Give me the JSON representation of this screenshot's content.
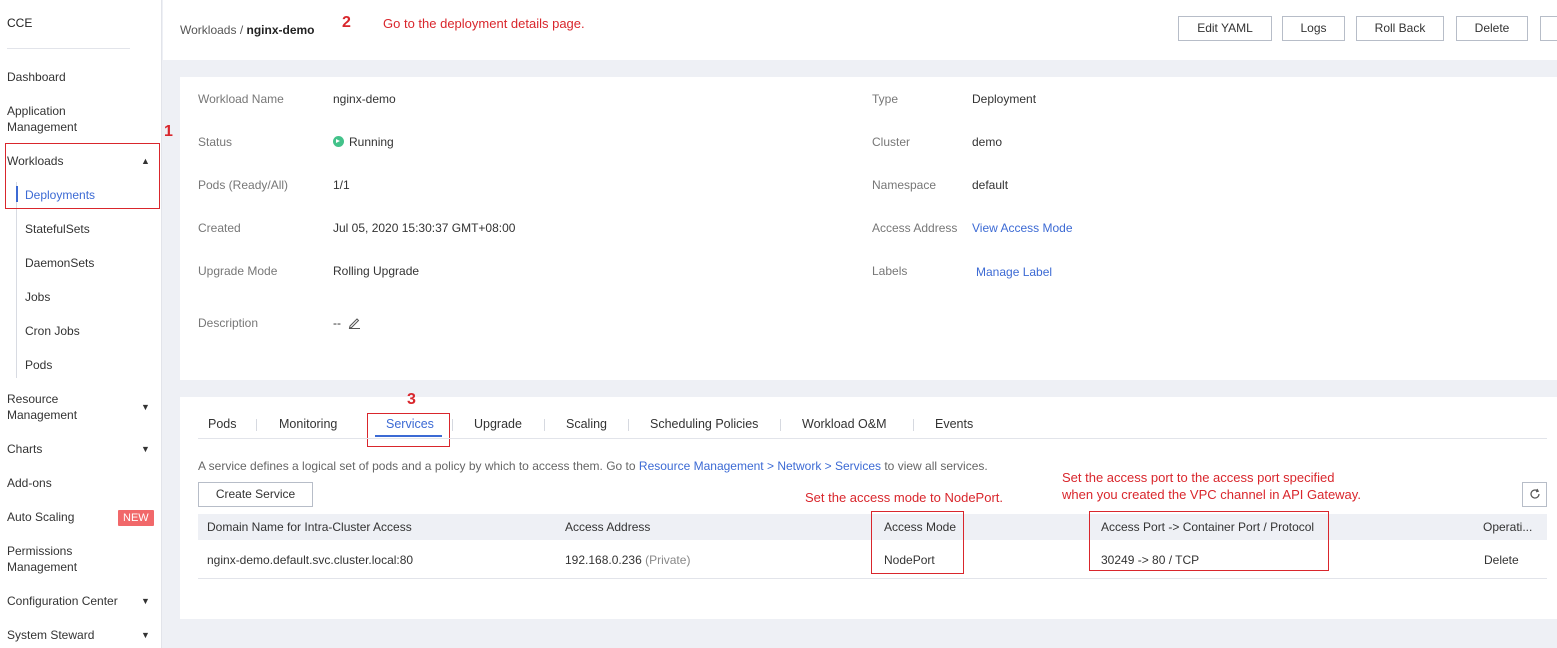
{
  "sidebar": {
    "brand": "CCE",
    "items": [
      {
        "label": "Dashboard"
      },
      {
        "label": "Application Management"
      },
      {
        "label": "Workloads"
      },
      {
        "label": "Deployments"
      },
      {
        "label": "StatefulSets"
      },
      {
        "label": "DaemonSets"
      },
      {
        "label": "Jobs"
      },
      {
        "label": "Cron Jobs"
      },
      {
        "label": "Pods"
      },
      {
        "label": "Resource Management"
      },
      {
        "label": "Charts"
      },
      {
        "label": "Add-ons"
      },
      {
        "label": "Auto Scaling",
        "badge": "NEW"
      },
      {
        "label": "Permissions Management"
      },
      {
        "label": "Configuration Center"
      },
      {
        "label": "System Steward"
      }
    ]
  },
  "breadcrumb": {
    "parent": "Workloads",
    "sep": "/",
    "current": "nginx-demo"
  },
  "header_buttons": [
    "Edit YAML",
    "Logs",
    "Roll Back",
    "Delete"
  ],
  "annotations": {
    "n1": "1",
    "n2": "2",
    "n2_text": "Go to the deployment details page.",
    "n3": "3",
    "mode_text": "Set the access mode to NodePort.",
    "port_text_1": "Set the access port to the access port specified",
    "port_text_2": "when you created the VPC channel in API Gateway."
  },
  "details": {
    "workload_name_label": "Workload Name",
    "workload_name": "nginx-demo",
    "status_label": "Status",
    "status": "Running",
    "pods_label": "Pods (Ready/All)",
    "pods": "1/1",
    "created_label": "Created",
    "created": "Jul 05, 2020 15:30:37 GMT+08:00",
    "upgrade_label": "Upgrade Mode",
    "upgrade": "Rolling Upgrade",
    "description_label": "Description",
    "description": "--",
    "type_label": "Type",
    "type": "Deployment",
    "cluster_label": "Cluster",
    "cluster": "demo",
    "namespace_label": "Namespace",
    "namespace": "default",
    "access_label": "Access Address",
    "access": "View Access Mode",
    "labels_label": "Labels",
    "labels": "Manage Label"
  },
  "tabs": [
    "Pods",
    "Monitoring",
    "Services",
    "Upgrade",
    "Scaling",
    "Scheduling Policies",
    "Workload O&M",
    "Events"
  ],
  "services": {
    "desc_prefix": "A service defines a logical set of pods and a policy by which to access them. Go to ",
    "desc_link": "Resource Management > Network > Services",
    "desc_suffix": " to view all services.",
    "create_label": "Create Service",
    "columns": [
      "Domain Name for Intra-Cluster Access",
      "Access Address",
      "Access Mode",
      "Access Port -> Container Port / Protocol",
      "Operati..."
    ],
    "rows": [
      {
        "domain": "nginx-demo.default.svc.cluster.local:80",
        "address": "192.168.0.236",
        "address_note": "(Private)",
        "mode": "NodePort",
        "ports": "30249 -> 80 / TCP",
        "op": "Delete"
      }
    ]
  },
  "colors": {
    "accent": "#3c6ad4",
    "annotation": "#d9262c",
    "running": "#43c28a",
    "badge": "#f1686a"
  }
}
